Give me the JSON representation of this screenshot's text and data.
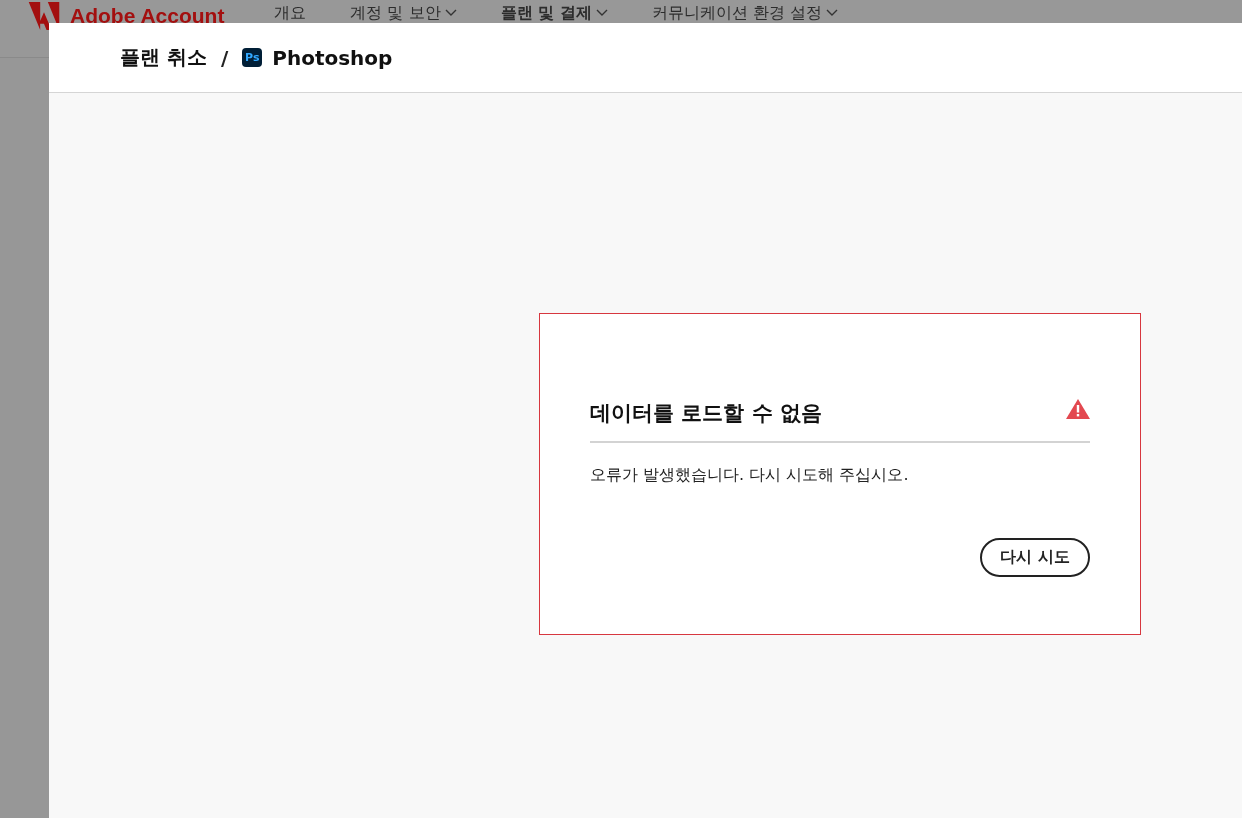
{
  "header": {
    "logo": "Adobe Account",
    "nav": [
      {
        "label": "개요",
        "selected": false,
        "dropdown": false
      },
      {
        "label": "계정 및 보안",
        "selected": false,
        "dropdown": true
      },
      {
        "label": "플랜 및 결제",
        "selected": true,
        "dropdown": true
      },
      {
        "label": "커뮤니케이션 환경 설정",
        "selected": false,
        "dropdown": true
      }
    ]
  },
  "dialog": {
    "breadcrumb": {
      "parent": "플랜 취소",
      "separator": "/",
      "app_badge": "Ps",
      "current": "Photoshop"
    },
    "error_card": {
      "title": "데이터를 로드할 수 없음",
      "message": "오류가 발생했습니다. 다시 시도해 주십시오.",
      "button": "다시 시도"
    }
  }
}
